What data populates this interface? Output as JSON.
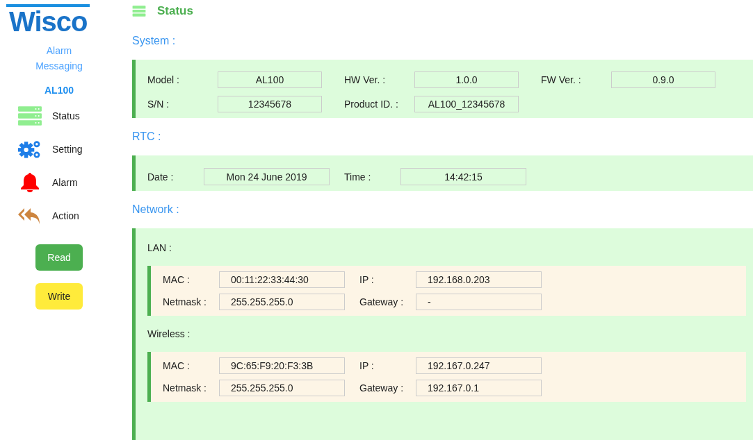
{
  "sidebar": {
    "logo": "Wisco",
    "subtitle": "Alarm Messaging",
    "model": "AL100",
    "items": [
      {
        "label": "Status",
        "kind": "status"
      },
      {
        "label": "Setting",
        "kind": "setting"
      },
      {
        "label": "Alarm",
        "kind": "alarm"
      },
      {
        "label": "Action",
        "kind": "action"
      }
    ],
    "buttons": [
      {
        "label": "Read",
        "kind": "read"
      },
      {
        "label": "Write",
        "kind": "write"
      }
    ]
  },
  "page_title": "Status",
  "sections": [
    {
      "title": "System :",
      "kind": "fields",
      "rows": [
        [
          {
            "label": "Model :",
            "value": "AL100"
          },
          {
            "label": "HW Ver. :",
            "value": "1.0.0"
          },
          {
            "label": "FW Ver. :",
            "value": "0.9.0"
          }
        ],
        [
          {
            "label": "S/N :",
            "value": "12345678"
          },
          {
            "label": "Product ID. :",
            "value": "AL100_12345678"
          }
        ]
      ]
    },
    {
      "title": "RTC :",
      "kind": "wide",
      "rows": [
        [
          {
            "label": "Date :",
            "value": "Mon 24 June 2019"
          },
          {
            "label": "Time :",
            "value": "14:42:15"
          }
        ]
      ]
    },
    {
      "title": "Network :",
      "kind": "network",
      "groups": [
        {
          "title": "LAN :",
          "rows": [
            [
              {
                "label": "MAC :",
                "value": "00:11:22:33:44:30"
              },
              {
                "label": "IP :",
                "value": "192.168.0.203"
              }
            ],
            [
              {
                "label": "Netmask :",
                "value": "255.255.255.0"
              },
              {
                "label": "Gateway :",
                "value": "-"
              }
            ]
          ]
        },
        {
          "title": "Wireless :",
          "rows": [
            [
              {
                "label": "MAC :",
                "value": "9C:65:F9:20:F3:3B"
              },
              {
                "label": "IP :",
                "value": "192.167.0.247"
              }
            ],
            [
              {
                "label": "Netmask :",
                "value": "255.255.255.0"
              },
              {
                "label": "Gateway :",
                "value": "192.167.0.1"
              }
            ]
          ]
        }
      ]
    }
  ]
}
